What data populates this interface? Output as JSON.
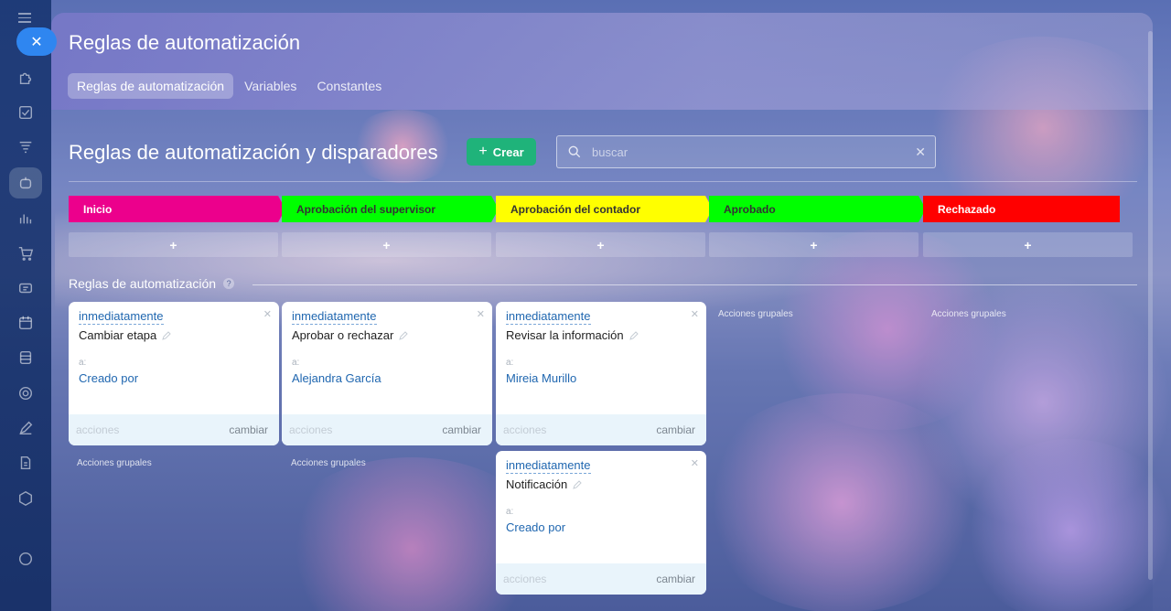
{
  "panel": {
    "title": "Reglas de automatización",
    "tabs": [
      {
        "label": "Reglas de automatización",
        "active": true
      },
      {
        "label": "Variables",
        "active": false
      },
      {
        "label": "Constantes",
        "active": false
      }
    ]
  },
  "header": {
    "title": "Reglas de automatización y disparadores",
    "create_label": "Crear",
    "search_placeholder": "buscar"
  },
  "stages": [
    {
      "label": "Inicio",
      "color": "#ec008c",
      "text_color": "#ffffff"
    },
    {
      "label": "Aprobación del supervisor",
      "color": "#00ff00",
      "text_color": "#333333"
    },
    {
      "label": "Aprobación del contador",
      "color": "#ffff00",
      "text_color": "#333333"
    },
    {
      "label": "Aprobado",
      "color": "#00ff00",
      "text_color": "#333333"
    },
    {
      "label": "Rechazado",
      "color": "#ff0000",
      "text_color": "#ffffff"
    }
  ],
  "add_symbol": "+",
  "rules_section": {
    "label": "Reglas de automatización",
    "help_icon": "question-icon"
  },
  "cards": [
    {
      "delay": "inmediatamente",
      "name": "Cambiar etapa",
      "to_label": "a:",
      "user": "Creado por",
      "actions_label": "acciones",
      "change_label": "cambiar"
    },
    {
      "delay": "inmediatamente",
      "name": "Aprobar o rechazar",
      "to_label": "a:",
      "user": "Alejandra García",
      "actions_label": "acciones",
      "change_label": "cambiar"
    },
    {
      "delay": "inmediatamente",
      "name": "Revisar la información",
      "to_label": "a:",
      "user": "Mireia Murillo",
      "actions_label": "acciones",
      "change_label": "cambiar"
    },
    {
      "delay": "inmediatamente",
      "name": "Notificación",
      "to_label": "a:",
      "user": "Creado por",
      "actions_label": "acciones",
      "change_label": "cambiar"
    }
  ],
  "group_actions_label": "Acciones grupales",
  "colors": {
    "accent_green": "#1fb37a",
    "link_blue": "#2067b0",
    "close_blue": "#2f86f0"
  }
}
